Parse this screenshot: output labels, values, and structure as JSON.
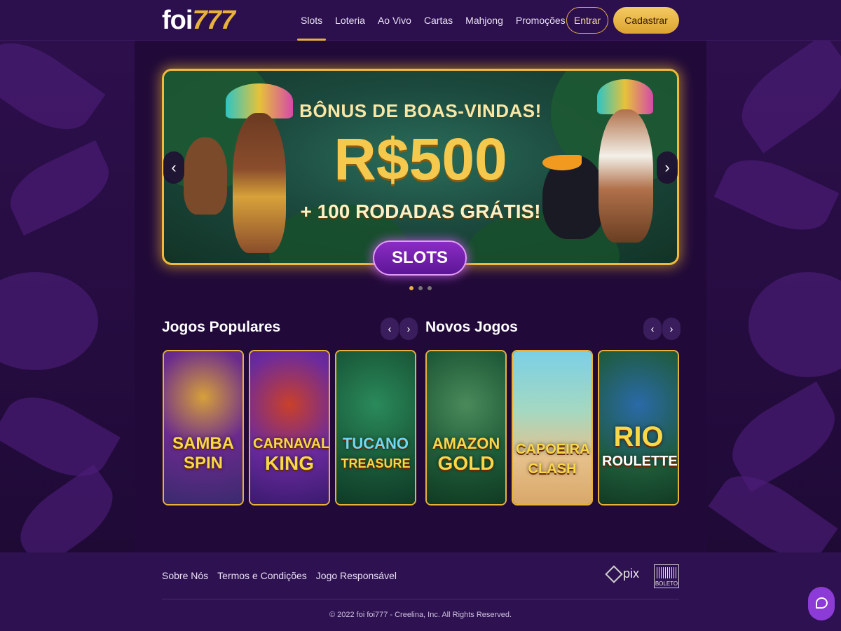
{
  "header": {
    "logo_word": "foi",
    "logo_num": "777",
    "nav": [
      {
        "label": "Slots",
        "active": true
      },
      {
        "label": "Loteria",
        "active": false
      },
      {
        "label": "Ao Vivo",
        "active": false
      },
      {
        "label": "Cartas",
        "active": false
      },
      {
        "label": "Mahjong",
        "active": false
      },
      {
        "label": "Promoções",
        "active": false
      }
    ],
    "login_label": "Entrar",
    "signup_label": "Cadastrar"
  },
  "banner": {
    "title": "BÔNUS DE BOAS-VINDAS!",
    "amount": "R$500",
    "subtitle": "+ 100 RODADAS GRÁTIS!",
    "cta": "SLOTS",
    "prev_icon": "chevron-left-icon",
    "next_icon": "chevron-right-icon",
    "slide_count": 3,
    "active_slide": 1
  },
  "popular": {
    "title": "Jogos Populares",
    "games": [
      {
        "line1": "SAMBA",
        "line2": "SPIN"
      },
      {
        "line1": "CARNAVAL",
        "line2": "KING"
      },
      {
        "line1": "TUCANO",
        "line2": "TREASURE"
      }
    ]
  },
  "new": {
    "title": "Novos Jogos",
    "games": [
      {
        "line1": "AMAZON",
        "line2": "GOLD"
      },
      {
        "line1": "CAPOEIRA",
        "line2": "CLASH"
      },
      {
        "line1": "RIO",
        "line2": "ROULETTE"
      }
    ]
  },
  "footer": {
    "links": [
      "Sobre Nós",
      "Termos e Condições",
      "Jogo Responsável"
    ],
    "pix_label": "pix",
    "boleto_label": "BOLETO",
    "copyright": "© 2022 foi foi777 - Creelina, Inc. All Rights Reserved."
  },
  "colors": {
    "accent": "#e8b23a",
    "background": "#230d3d",
    "cta_purple": "#8a2cc4"
  }
}
